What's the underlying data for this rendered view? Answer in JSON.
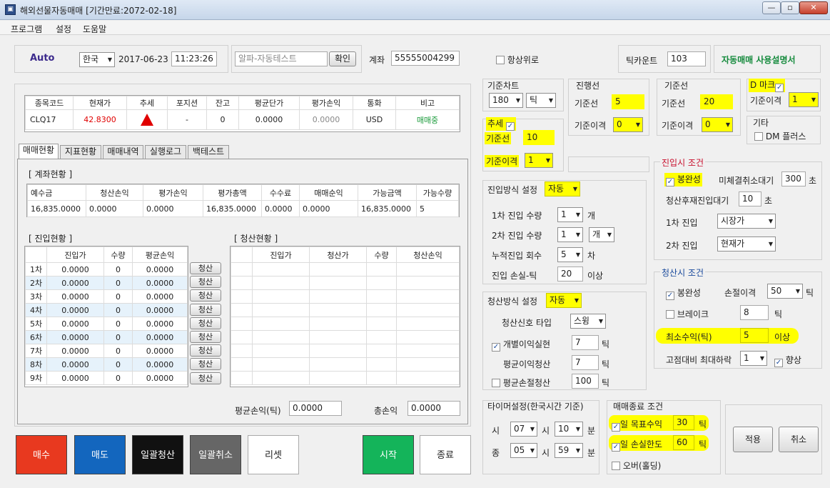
{
  "window": {
    "title": "해외선물자동매매 [기간만료:2072-02-18]",
    "minimize": "—",
    "restore": "▫",
    "close": "✕"
  },
  "menu": [
    "프로그램",
    "설정",
    "도움말"
  ],
  "header": {
    "mode": "Auto",
    "country": "한국",
    "date": "2017-06-23",
    "time": "11:23:26",
    "strategy": "알파-자동테스트",
    "confirm": "확인",
    "account_label": "계좌",
    "account": "55555004299",
    "topmost": "항상위로",
    "tick_count_label": "틱카운트",
    "tick_count": "103",
    "manual": "자동매매 사용설명서"
  },
  "quote": {
    "headers": [
      "종목코드",
      "현재가",
      "추세",
      "포지션",
      "잔고",
      "평균단가",
      "평가손익",
      "통화",
      "비고"
    ],
    "row": {
      "code": "CLQ17",
      "price": "42.8300",
      "position": "-",
      "balance": "0",
      "avg": "0.0000",
      "pnl": "0.0000",
      "currency": "USD",
      "note": "매매중"
    }
  },
  "tabs": [
    "매매현황",
    "지표현황",
    "매매내역",
    "실행로그",
    "백테스트"
  ],
  "account_status": {
    "title": "[ 계좌현황 ]",
    "headers": [
      "예수금",
      "청산손익",
      "평가손익",
      "평가총액",
      "수수료",
      "매매순익",
      "가능금액",
      "가능수량"
    ],
    "values": [
      "16,835.0000",
      "0.0000",
      "0.0000",
      "16,835.0000",
      "0.0000",
      "0.0000",
      "16,835.0000",
      "5"
    ]
  },
  "entry_status": {
    "title": "[ 진입현황 ]",
    "headers": [
      "",
      "진입가",
      "수량",
      "평균손익"
    ],
    "rows": [
      [
        "1차",
        "0.0000",
        "0",
        "0.0000"
      ],
      [
        "2차",
        "0.0000",
        "0",
        "0.0000"
      ],
      [
        "3차",
        "0.0000",
        "0",
        "0.0000"
      ],
      [
        "4차",
        "0.0000",
        "0",
        "0.0000"
      ],
      [
        "5차",
        "0.0000",
        "0",
        "0.0000"
      ],
      [
        "6차",
        "0.0000",
        "0",
        "0.0000"
      ],
      [
        "7차",
        "0.0000",
        "0",
        "0.0000"
      ],
      [
        "8차",
        "0.0000",
        "0",
        "0.0000"
      ],
      [
        "9차",
        "0.0000",
        "0",
        "0.0000"
      ]
    ],
    "liquidate": "청산"
  },
  "liquidation_status": {
    "title": "[ 청산현황 ]",
    "headers": [
      "",
      "진입가",
      "청산가",
      "수량",
      "청산손익"
    ]
  },
  "avg_pnl": {
    "label": "평균손익(틱)",
    "value": "0.0000"
  },
  "total_pnl": {
    "label": "총손익",
    "value": "0.0000"
  },
  "actions": {
    "buy": "매수",
    "sell": "매도",
    "liquidate_all": "일괄청산",
    "cancel_all": "일괄취소",
    "reset": "리셋",
    "start": "시작",
    "stop": "종료"
  },
  "chart_base": {
    "title": "기준차트",
    "value": "180",
    "unit": "틱"
  },
  "lead_line": {
    "title": "진행선",
    "base_label": "기준선",
    "base": "5",
    "shift_label": "기준이격",
    "shift": "0"
  },
  "base_line": {
    "title": "기준선",
    "base_label": "기준선",
    "base": "20",
    "shift_label": "기준이격",
    "shift": "0"
  },
  "dmark": {
    "title": "D 마크",
    "shift_label": "기준이격",
    "shift": "1"
  },
  "trend": {
    "title": "추세",
    "base_label": "기준선",
    "base": "10",
    "shift_label": "기준이격",
    "shift": "1"
  },
  "etc": {
    "title": "기타",
    "dm_plus": "DM 플러스"
  },
  "entry_method": {
    "title": "진입방식 설정",
    "mode": "자동",
    "first_qty_label": "1차 진입 수량",
    "first_qty": "1",
    "first_unit": "개",
    "second_qty_label": "2차 진입 수량",
    "second_qty": "1",
    "second_unit": "개",
    "count_label": "누적진입 회수",
    "count": "5",
    "count_unit": "차",
    "loss_label": "진입 손실-틱",
    "loss": "20",
    "loss_unit": "이상"
  },
  "liquidation_method": {
    "title": "청산방식 설정",
    "mode": "자동",
    "signal_label": "청산신호 타입",
    "signal": "스윙",
    "individual_label": "개별이익실현",
    "individual": "7",
    "individual_unit": "틱",
    "avg_profit_label": "평균이익청산",
    "avg_profit": "7",
    "avg_profit_unit": "틱",
    "avg_loss_label": "평균손절청산",
    "avg_loss": "100",
    "avg_loss_unit": "틱"
  },
  "entry_condition": {
    "title": "진입시 조건",
    "complete": "봉완성",
    "wait_label": "미체결취소대기",
    "wait": "300",
    "wait_unit": "초",
    "re_label": "청산후재진입대기",
    "re": "10",
    "re_unit": "초",
    "first_label": "1차 진입",
    "first": "시장가",
    "second_label": "2차 진입",
    "second": "현재가"
  },
  "liquidation_condition": {
    "title": "청산시 조건",
    "complete": "봉완성",
    "stop_label": "손절이격",
    "stop": "50",
    "stop_unit": "틱",
    "break_label": "브레이크",
    "break": "8",
    "break_unit": "틱",
    "min_label": "최소수익(틱)",
    "min": "5",
    "min_unit": "이상",
    "high_label": "고점대비 최대하락",
    "high": "1",
    "up": "향상"
  },
  "timer": {
    "title": "타이머설정(한국시간 기준)",
    "start_label": "시",
    "start_h": "07",
    "start_h_unit": "시",
    "start_m": "10",
    "start_m_unit": "분",
    "end_label": "종",
    "end_h": "05",
    "end_h_unit": "시",
    "end_m": "59",
    "end_m_unit": "분"
  },
  "end_condition": {
    "title": "매매종료 조건",
    "target_label": "일 목표수익",
    "target": "30",
    "target_unit": "틱",
    "loss_label": "일 손실한도",
    "loss": "60",
    "loss_unit": "틱",
    "over": "오버(홀딩)"
  },
  "footer": {
    "apply": "적용",
    "cancel": "취소"
  },
  "colors": {
    "buy": "#e8391f",
    "sell": "#1366be",
    "dark": "#111111",
    "gray": "#666666",
    "start": "#14b45a",
    "price": "#e00000",
    "status": "#1a9a3a",
    "section_title": "#c8102e",
    "manual": "#148a3c"
  }
}
